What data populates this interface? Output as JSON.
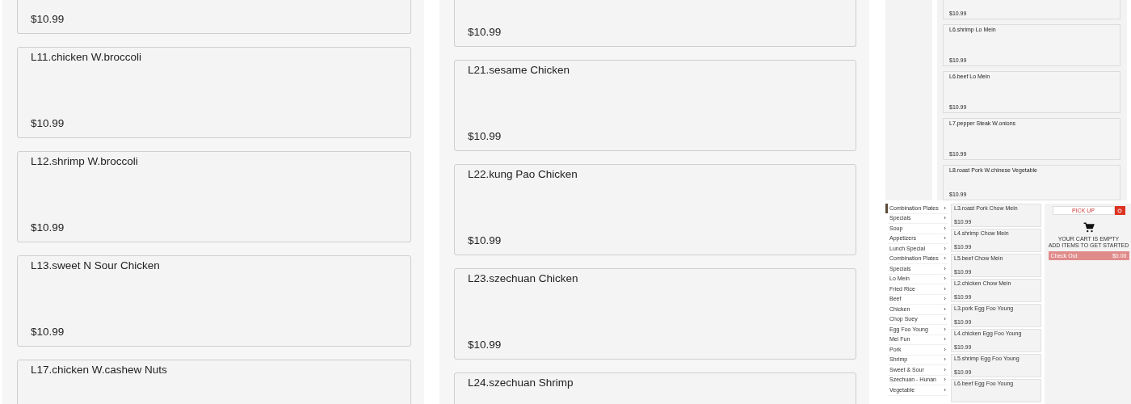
{
  "panels": [
    {
      "kind": "menu",
      "items": [
        {
          "price": "$10.99"
        },
        {
          "title": "L11.chicken W.broccoli",
          "price": "$10.99"
        },
        {
          "title": "L12.shrimp W.broccoli",
          "price": "$10.99"
        },
        {
          "title": "L13.sweet N Sour Chicken",
          "price": "$10.99"
        },
        {
          "title": "L17.chicken W.cashew Nuts"
        }
      ]
    },
    {
      "kind": "menu",
      "items": [
        {
          "price": "$10.99"
        },
        {
          "title": "L21.sesame Chicken",
          "price": "$10.99"
        },
        {
          "title": "L22.kung Pao Chicken",
          "price": "$10.99"
        },
        {
          "title": "L23.szechuan Chicken",
          "price": "$10.99"
        },
        {
          "title": "L24.szechuan Shrimp"
        }
      ]
    },
    {
      "kind": "mini_menu",
      "items": [
        {
          "price": "$10.99"
        },
        {
          "title": "L6.shrimp Lo Mein",
          "price": "$10.99"
        },
        {
          "title": "L6.beef Lo Mein",
          "price": "$10.99"
        },
        {
          "title": "L7.pepper Steak W.onions",
          "price": "$10.99"
        },
        {
          "title": "L8.roast Pork W.chinese Vegetable",
          "price": "$10.99"
        }
      ]
    },
    {
      "kind": "mini_page",
      "categories": [
        "Combination Plates",
        "Specials",
        "Soup",
        "Appetizers",
        "Lunch Special",
        "Combination Plates",
        "Specials",
        "Lo Mein",
        "Fried Rice",
        "Beef",
        "Chicken",
        "Chop Suey",
        "Egg Foo Young",
        "Mei Fun",
        "Pork",
        "Shrimp",
        "Sweet & Sour",
        "Szechuan - Hunan",
        "Vegetable"
      ],
      "chevron": "›",
      "items": [
        {
          "title": "L3.roast Pork Chow Mein",
          "price": "$10.99"
        },
        {
          "title": "L4.shrimp Chow Mein",
          "price": "$10.99"
        },
        {
          "title": "L5.beef Chow Mein",
          "price": "$10.99"
        },
        {
          "title": "L2.chicken Chow Mein",
          "price": "$10.99"
        },
        {
          "title": "L3.pork Egg Foo Young",
          "price": "$10.99"
        },
        {
          "title": "L4.chicken Egg Foo Young",
          "price": "$10.99"
        },
        {
          "title": "L5.shrimp Egg Foo Young",
          "price": "$10.99"
        },
        {
          "title": "L6.beef Egg Foo Young"
        }
      ],
      "cart": {
        "pickup": "PICK UP",
        "empty": "YOUR CART IS EMPTY",
        "hint": "ADD ITEMS TO GET STARTED",
        "checkout": "Check Out",
        "total": "$0.00"
      }
    }
  ]
}
